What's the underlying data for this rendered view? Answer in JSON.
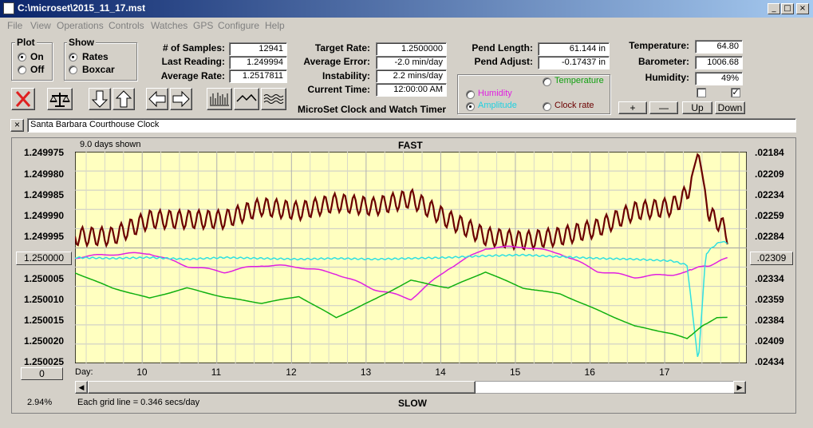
{
  "window": {
    "title": "C:\\microset\\2015_11_17.mst",
    "min": "_",
    "max": "□",
    "close": "×"
  },
  "menu": [
    "File",
    "View",
    "Operations",
    "Controls",
    "Watches",
    "GPS",
    "Configure",
    "Help"
  ],
  "plot_group": {
    "title": "Plot",
    "on": "On",
    "off": "Off",
    "selected": "on"
  },
  "show_group": {
    "title": "Show",
    "rates": "Rates",
    "boxcar": "Boxcar",
    "selected": "rates"
  },
  "stats": {
    "samples_label": "# of Samples:",
    "samples": "12941",
    "last_label": "Last Reading:",
    "last": "1.249994",
    "avg_rate_label": "Average Rate:",
    "avg_rate": "1.2517811",
    "target_label": "Target Rate:",
    "target": "1.2500000",
    "avg_err_label": "Average Error:",
    "avg_err": "-2.0 min/day",
    "instab_label": "Instability:",
    "instab": "2.2 mins/day",
    "time_label": "Current Time:",
    "time": "12:00:00 AM",
    "pend_len_label": "Pend Length:",
    "pend_len": "61.144 in",
    "pend_adj_label": "Pend Adjust:",
    "pend_adj": "-0.17437 in",
    "temp_label": "Temperature:",
    "temp": "64.80",
    "baro_label": "Barometer:",
    "baro": "1006.68",
    "hum_label": "Humidity:",
    "hum": "49%"
  },
  "app_name": "MicroSet Clock and Watch Timer",
  "overlay": {
    "temperature": "Temperature",
    "humidity": "Humidity",
    "amplitude": "Amplitude",
    "clock_rate": "Clock rate",
    "selected": "amplitude"
  },
  "scale_buttons": {
    "plus": "+",
    "minus": "—",
    "up": "Up",
    "down": "Down"
  },
  "checks": {
    "first": false,
    "second": true
  },
  "clock_name": "Santa Barbara Courthouse Clock",
  "clear_label": "×",
  "plot": {
    "days_shown": "9.0 days shown",
    "fast": "FAST",
    "slow": "SLOW",
    "day_label": "Day:",
    "grid_note": "Each grid line = 0.346 secs/day",
    "percent": "2.94%",
    "center_left": "1.250000",
    "center_right": ".02309",
    "bottom_left": "0",
    "left_ticks": [
      "1.249975",
      "1.249980",
      "1.249985",
      "1.249990",
      "1.249995",
      "1.250005",
      "1.250010",
      "1.250015",
      "1.250020",
      "1.250025"
    ],
    "right_ticks": [
      ".02184",
      ".02209",
      ".02234",
      ".02259",
      ".02284",
      ".02334",
      ".02359",
      ".02384",
      ".02409",
      ".02434"
    ],
    "days": [
      "10",
      "11",
      "12",
      "13",
      "14",
      "15",
      "16",
      "17"
    ],
    "colors": {
      "bg": "#ffffc0",
      "rate": "#6b0000",
      "humidity": "#e020e0",
      "amplitude": "#30e0e0",
      "temperature": "#10b010",
      "grid": "#c8c8c8"
    }
  },
  "chart_data": {
    "type": "line",
    "xlabel": "Day:",
    "x_range": [
      9.1,
      18.1
    ],
    "ylim_left": [
      1.249975,
      1.250025
    ],
    "ylim_right": [
      0.02184,
      0.02434
    ],
    "series": [
      {
        "name": "",
        "axis": "left",
        "x": [
          9.1,
          9.6,
          10.1,
          10.6,
          11.1,
          11.6,
          12.1,
          12.6,
          13.1,
          13.6,
          14.1,
          14.6,
          15.1,
          15.6,
          16.1,
          16.6,
          17.1,
          17.3,
          17.45,
          17.6,
          17.75,
          17.85
        ],
        "y": [
          1.249995,
          1.249995,
          1.249991,
          1.249991,
          1.249991,
          1.249988,
          1.249989,
          1.249987,
          1.249988,
          1.249986,
          1.249991,
          1.249995,
          1.249996,
          1.249995,
          1.249993,
          1.249989,
          1.249988,
          1.249985,
          1.249975,
          1.24999,
          1.249992,
          1.249995
        ]
      },
      {
        "name": "Humidity",
        "axis": "right",
        "x": [
          9.1,
          9.6,
          10.1,
          10.6,
          11.1,
          11.6,
          12.1,
          12.6,
          13.1,
          13.6,
          14.1,
          14.6,
          15.1,
          15.6,
          16.1,
          16.6,
          17.1,
          17.3,
          17.45,
          17.6,
          17.75,
          17.85
        ],
        "y": [
          0.02309,
          0.02305,
          0.02304,
          0.02319,
          0.02326,
          0.02318,
          0.0232,
          0.02328,
          0.02346,
          0.02358,
          0.02322,
          0.02298,
          0.02296,
          0.02304,
          0.02325,
          0.02332,
          0.02329,
          0.02326,
          0.0232,
          0.02318,
          0.02312,
          0.0231
        ]
      },
      {
        "name": "Amplitude",
        "axis": "right",
        "x": [
          9.1,
          9.6,
          10.1,
          10.6,
          11.1,
          11.6,
          12.1,
          12.6,
          13.1,
          13.6,
          14.1,
          14.6,
          15.1,
          15.6,
          16.1,
          16.6,
          17.1,
          17.3,
          17.45,
          17.55,
          17.65,
          17.75,
          17.85
        ],
        "y": [
          0.02309,
          0.0231,
          0.02309,
          0.02311,
          0.02309,
          0.0231,
          0.02311,
          0.0231,
          0.02311,
          0.0231,
          0.02309,
          0.02307,
          0.02306,
          0.02308,
          0.0231,
          0.02311,
          0.02313,
          0.02318,
          0.02434,
          0.02305,
          0.02296,
          0.0229,
          0.02292
        ]
      },
      {
        "name": "Temperature",
        "axis": "right",
        "x": [
          9.1,
          9.6,
          10.1,
          10.6,
          11.1,
          11.6,
          12.1,
          12.6,
          13.1,
          13.6,
          14.1,
          14.6,
          15.1,
          15.6,
          16.1,
          16.6,
          17.1,
          17.3,
          17.5,
          17.7,
          17.85
        ],
        "y": [
          0.02327,
          0.02345,
          0.02357,
          0.02345,
          0.02356,
          0.02363,
          0.02355,
          0.0238,
          0.02359,
          0.02336,
          0.02345,
          0.02326,
          0.02345,
          0.02352,
          0.02371,
          0.0239,
          0.02399,
          0.02405,
          0.0239,
          0.0238,
          0.0238
        ]
      }
    ]
  }
}
